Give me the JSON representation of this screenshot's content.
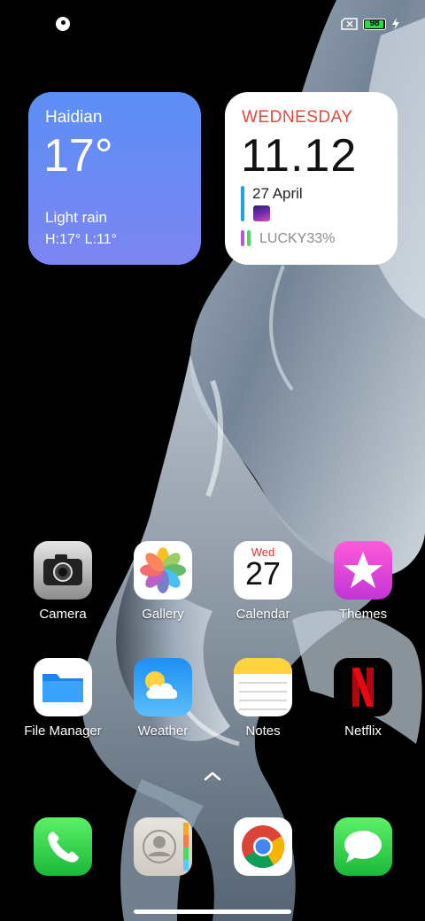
{
  "status_bar": {
    "left_icon": "notification-app-icon",
    "battery_level": "98",
    "battery_fraction": 0.98,
    "icons": [
      "no-sim-icon",
      "battery-icon",
      "charging-bolt-icon"
    ]
  },
  "weather_widget": {
    "city": "Haidian",
    "temperature": "17°",
    "condition": "Light rain",
    "high_low": "H:17°  L:11°"
  },
  "calendar_widget": {
    "weekday": "WEDNESDAY",
    "time": "11.12",
    "date": "27 April",
    "event_text": "LUCKY33%",
    "colors": {
      "weekday": "#e8463a",
      "bar_blue": "#1fa3e8",
      "bar_purple": "#b25ad8",
      "bar_green": "#4cd964"
    }
  },
  "apps": [
    {
      "label": "Camera",
      "icon": "camera-icon"
    },
    {
      "label": "Gallery",
      "icon": "photos-flower-icon"
    },
    {
      "label": "Calendar",
      "icon": "calendar-icon",
      "weekday": "Wed",
      "day": "27"
    },
    {
      "label": "Themes",
      "icon": "star-icon"
    },
    {
      "label": "File Manager",
      "icon": "folder-icon"
    },
    {
      "label": "Weather",
      "icon": "sun-cloud-icon"
    },
    {
      "label": "Notes",
      "icon": "notepad-icon"
    },
    {
      "label": "Netflix",
      "icon": "netflix-n-icon"
    }
  ],
  "dock": [
    {
      "name": "Phone",
      "icon": "phone-icon"
    },
    {
      "name": "Contacts",
      "icon": "contacts-icon"
    },
    {
      "name": "Chrome",
      "icon": "chrome-icon"
    },
    {
      "name": "Messages",
      "icon": "message-bubble-icon"
    }
  ],
  "app_drawer": {
    "icon": "chevron-up-icon"
  }
}
